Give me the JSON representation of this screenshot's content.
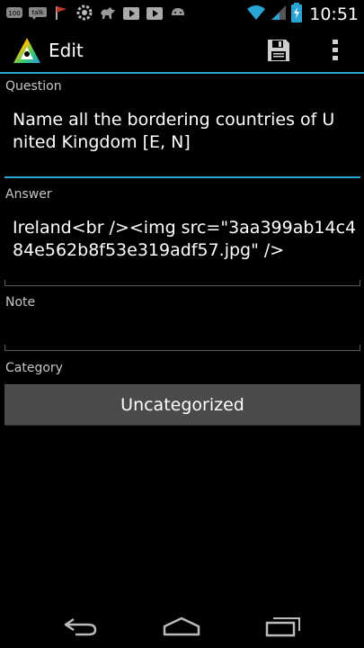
{
  "status_bar": {
    "time": "10:51",
    "notification_icons": [
      "100",
      "talk"
    ]
  },
  "action_bar": {
    "title": "Edit",
    "icons": [
      "app-logo-icon",
      "save-icon",
      "overflow-menu-icon"
    ]
  },
  "form": {
    "question": {
      "label": "Question",
      "value": "Name all the bordering countries of United Kingdom [E, N]"
    },
    "answer": {
      "label": "Answer",
      "value": "Ireland<br /><img src=\"3aa399ab14c484e562b8f53e319adf57.jpg\" />"
    },
    "note": {
      "label": "Note",
      "value": ""
    },
    "category": {
      "label": "Category",
      "button_label": "Uncategorized"
    }
  },
  "colors": {
    "accent": "#2aa3d5",
    "background": "#000000",
    "button": "#4a4a4a"
  },
  "nav_bar": {
    "icons": [
      "back-icon",
      "home-icon",
      "recent-apps-icon"
    ]
  }
}
